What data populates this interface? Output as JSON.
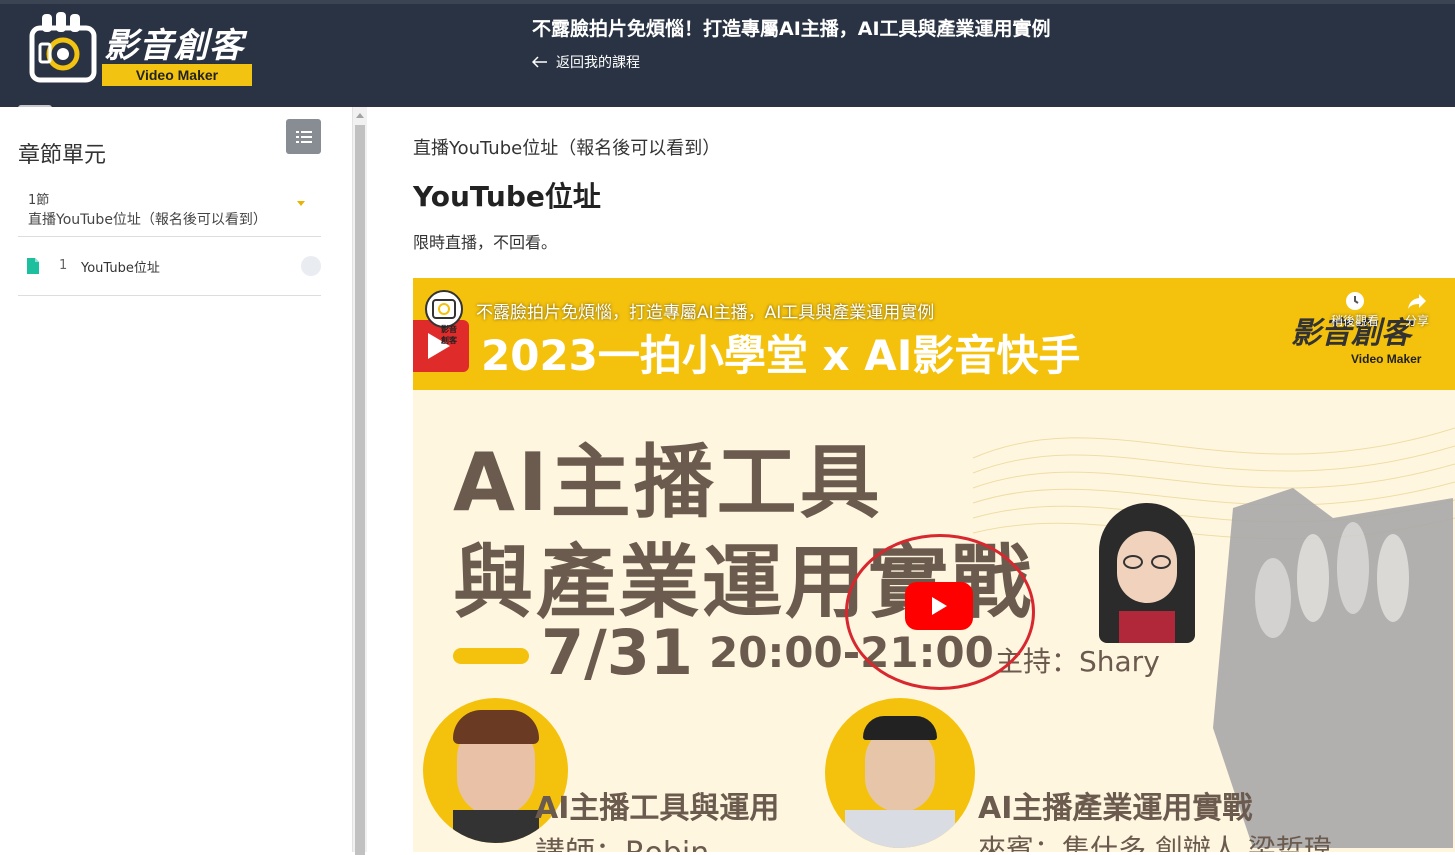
{
  "header": {
    "logo_text": "影音創客",
    "logo_sub": "Video Maker",
    "course_title": "不露臉拍片免煩惱！打造專屬AI主播，AI工具與產業運用實例",
    "back_label": "返回我的課程"
  },
  "sidebar": {
    "title": "章節單元",
    "chapter": {
      "number": "1節",
      "name": "直播YouTube位址（報名後可以看到）"
    },
    "lessons": [
      {
        "index": "1",
        "label": "YouTube位址",
        "icon": "file-icon"
      }
    ]
  },
  "main": {
    "unit_label": "直播YouTube位址（報名後可以看到）",
    "lesson_title": "YouTube位址",
    "description": "限時直播，不回看。",
    "video": {
      "channel_label": "影音創客",
      "title": "不露臉拍片免煩惱，打造專屬AI主播，AI工具與產業運用實例",
      "headline": "2023一拍小學堂 x AI影音快手",
      "brand": "影音創客",
      "brand_sub": "Video Maker",
      "watch_later": "稍後觀看",
      "share": "分享",
      "main_line1": "AI主播工具",
      "main_line2": "與產業運用實戰",
      "date": "7/31",
      "time": "20:00-21:00",
      "host": "主持：Shary",
      "speaker1_topic": "AI主播工具與運用",
      "speaker1_name": "講師：Robin",
      "speaker2_topic": "AI主播產業運用實戰",
      "speaker2_name": "來賓：集什多 創辦人 梁哲瑋"
    }
  },
  "colors": {
    "topbar": "#2a3343",
    "accent_yellow": "#f4c20d",
    "youtube_red": "#ff0000",
    "file_icon": "#1dbf9f"
  }
}
